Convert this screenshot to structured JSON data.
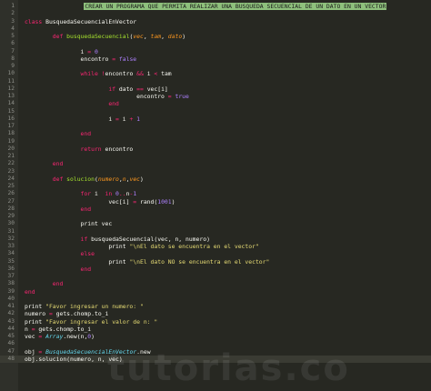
{
  "editor": {
    "lines": [
      {
        "n": "1",
        "segments": [
          {
            "t": "                 ",
            "c": "plain"
          },
          {
            "t": "CREAR UN PROGRAMA QUE PERMITA REALIZAR UNA BUSQUEDA SECUENCIAL DE UN DATO EN UN VECTOR",
            "c": "comment-hl"
          }
        ]
      },
      {
        "n": "2",
        "segments": [
          {
            "t": "",
            "c": "plain"
          }
        ]
      },
      {
        "n": "3",
        "segments": [
          {
            "t": "class ",
            "c": "kw"
          },
          {
            "t": "BusquedaSecuencialEnVector",
            "c": "plain"
          }
        ]
      },
      {
        "n": "4",
        "segments": [
          {
            "t": "",
            "c": "plain"
          }
        ]
      },
      {
        "n": "5",
        "segments": [
          {
            "t": "        def ",
            "c": "kw"
          },
          {
            "t": "busquedaSecuencial",
            "c": "fn"
          },
          {
            "t": "(",
            "c": "plain"
          },
          {
            "t": "vec",
            "c": "param"
          },
          {
            "t": ", ",
            "c": "plain"
          },
          {
            "t": "tam",
            "c": "param"
          },
          {
            "t": ", ",
            "c": "plain"
          },
          {
            "t": "dato",
            "c": "param"
          },
          {
            "t": ")",
            "c": "plain"
          }
        ]
      },
      {
        "n": "6",
        "segments": [
          {
            "t": "",
            "c": "plain"
          }
        ]
      },
      {
        "n": "7",
        "segments": [
          {
            "t": "                i ",
            "c": "plain"
          },
          {
            "t": "=",
            "c": "kw"
          },
          {
            "t": " ",
            "c": "plain"
          },
          {
            "t": "0",
            "c": "num"
          }
        ]
      },
      {
        "n": "8",
        "segments": [
          {
            "t": "                encontro ",
            "c": "plain"
          },
          {
            "t": "=",
            "c": "kw"
          },
          {
            "t": " ",
            "c": "plain"
          },
          {
            "t": "false",
            "c": "num"
          }
        ]
      },
      {
        "n": "9",
        "segments": [
          {
            "t": "",
            "c": "plain"
          }
        ]
      },
      {
        "n": "10",
        "segments": [
          {
            "t": "                while ",
            "c": "kw"
          },
          {
            "t": "!",
            "c": "kw"
          },
          {
            "t": "encontro ",
            "c": "plain"
          },
          {
            "t": "&&",
            "c": "kw"
          },
          {
            "t": " i ",
            "c": "plain"
          },
          {
            "t": "<",
            "c": "kw"
          },
          {
            "t": " tam",
            "c": "plain"
          }
        ]
      },
      {
        "n": "11",
        "segments": [
          {
            "t": "",
            "c": "plain"
          }
        ]
      },
      {
        "n": "12",
        "segments": [
          {
            "t": "                        if ",
            "c": "kw"
          },
          {
            "t": "dato ",
            "c": "plain"
          },
          {
            "t": "==",
            "c": "kw"
          },
          {
            "t": " vec[i]",
            "c": "plain"
          }
        ]
      },
      {
        "n": "13",
        "segments": [
          {
            "t": "                                encontro ",
            "c": "plain"
          },
          {
            "t": "=",
            "c": "kw"
          },
          {
            "t": " ",
            "c": "plain"
          },
          {
            "t": "true",
            "c": "num"
          }
        ]
      },
      {
        "n": "14",
        "segments": [
          {
            "t": "                        end",
            "c": "kw"
          }
        ]
      },
      {
        "n": "15",
        "segments": [
          {
            "t": "",
            "c": "plain"
          }
        ]
      },
      {
        "n": "16",
        "segments": [
          {
            "t": "                        i ",
            "c": "plain"
          },
          {
            "t": "=",
            "c": "kw"
          },
          {
            "t": " i ",
            "c": "plain"
          },
          {
            "t": "+",
            "c": "kw"
          },
          {
            "t": " ",
            "c": "plain"
          },
          {
            "t": "1",
            "c": "num"
          }
        ]
      },
      {
        "n": "17",
        "segments": [
          {
            "t": "",
            "c": "plain"
          }
        ]
      },
      {
        "n": "18",
        "segments": [
          {
            "t": "                end",
            "c": "kw"
          }
        ]
      },
      {
        "n": "19",
        "segments": [
          {
            "t": "",
            "c": "plain"
          }
        ]
      },
      {
        "n": "20",
        "segments": [
          {
            "t": "                return ",
            "c": "kw"
          },
          {
            "t": "encontro",
            "c": "plain"
          }
        ]
      },
      {
        "n": "21",
        "segments": [
          {
            "t": "",
            "c": "plain"
          }
        ]
      },
      {
        "n": "22",
        "segments": [
          {
            "t": "        end",
            "c": "kw"
          }
        ]
      },
      {
        "n": "23",
        "segments": [
          {
            "t": "",
            "c": "plain"
          }
        ]
      },
      {
        "n": "24",
        "segments": [
          {
            "t": "        def ",
            "c": "kw"
          },
          {
            "t": "solucion",
            "c": "fn"
          },
          {
            "t": "(",
            "c": "plain"
          },
          {
            "t": "numero",
            "c": "param"
          },
          {
            "t": ",",
            "c": "plain"
          },
          {
            "t": "n",
            "c": "param"
          },
          {
            "t": ",",
            "c": "plain"
          },
          {
            "t": "vec",
            "c": "param"
          },
          {
            "t": ")",
            "c": "plain"
          }
        ]
      },
      {
        "n": "25",
        "segments": [
          {
            "t": "",
            "c": "plain"
          }
        ]
      },
      {
        "n": "26",
        "segments": [
          {
            "t": "                for ",
            "c": "kw"
          },
          {
            "t": "i  ",
            "c": "plain"
          },
          {
            "t": "in ",
            "c": "kw"
          },
          {
            "t": "0",
            "c": "num"
          },
          {
            "t": "..",
            "c": "kw"
          },
          {
            "t": "n",
            "c": "plain"
          },
          {
            "t": "-",
            "c": "kw"
          },
          {
            "t": "1",
            "c": "num"
          }
        ]
      },
      {
        "n": "27",
        "segments": [
          {
            "t": "                        vec[i] ",
            "c": "plain"
          },
          {
            "t": "=",
            "c": "kw"
          },
          {
            "t": " rand(",
            "c": "plain"
          },
          {
            "t": "1001",
            "c": "num"
          },
          {
            "t": ")",
            "c": "plain"
          }
        ]
      },
      {
        "n": "28",
        "segments": [
          {
            "t": "                end",
            "c": "kw"
          }
        ]
      },
      {
        "n": "29",
        "segments": [
          {
            "t": "",
            "c": "plain"
          }
        ]
      },
      {
        "n": "30",
        "segments": [
          {
            "t": "                print ",
            "c": "plain"
          },
          {
            "t": "vec",
            "c": "plain"
          }
        ]
      },
      {
        "n": "31",
        "segments": [
          {
            "t": "",
            "c": "plain"
          }
        ]
      },
      {
        "n": "32",
        "segments": [
          {
            "t": "                if ",
            "c": "kw"
          },
          {
            "t": "busquedaSecuencial(vec, n, numero)",
            "c": "plain"
          }
        ]
      },
      {
        "n": "33",
        "segments": [
          {
            "t": "                        print ",
            "c": "plain"
          },
          {
            "t": "\"\\nEl dato se encuentra en el vector\"",
            "c": "str"
          }
        ]
      },
      {
        "n": "34",
        "segments": [
          {
            "t": "                else",
            "c": "kw"
          }
        ]
      },
      {
        "n": "35",
        "segments": [
          {
            "t": "                        print ",
            "c": "plain"
          },
          {
            "t": "\"\\nEl dato NO se encuentra en el vector\"",
            "c": "str"
          }
        ]
      },
      {
        "n": "36",
        "segments": [
          {
            "t": "                end",
            "c": "kw"
          }
        ]
      },
      {
        "n": "37",
        "segments": [
          {
            "t": "",
            "c": "plain"
          }
        ]
      },
      {
        "n": "38",
        "segments": [
          {
            "t": "        end",
            "c": "kw"
          }
        ]
      },
      {
        "n": "39",
        "segments": [
          {
            "t": "end",
            "c": "kw"
          }
        ]
      },
      {
        "n": "40",
        "segments": [
          {
            "t": "",
            "c": "plain"
          }
        ]
      },
      {
        "n": "41",
        "segments": [
          {
            "t": "print ",
            "c": "plain"
          },
          {
            "t": "\"Favor ingresar un numero: \"",
            "c": "str"
          }
        ]
      },
      {
        "n": "42",
        "segments": [
          {
            "t": "numero ",
            "c": "plain"
          },
          {
            "t": "=",
            "c": "kw"
          },
          {
            "t": " gets.chomp.to_i",
            "c": "plain"
          }
        ]
      },
      {
        "n": "43",
        "segments": [
          {
            "t": "print ",
            "c": "plain"
          },
          {
            "t": "\"Favor ingresar el valor de n: \"",
            "c": "str"
          }
        ]
      },
      {
        "n": "44",
        "segments": [
          {
            "t": "n ",
            "c": "plain"
          },
          {
            "t": "=",
            "c": "kw"
          },
          {
            "t": " gets.chomp.to_i",
            "c": "plain"
          }
        ]
      },
      {
        "n": "45",
        "segments": [
          {
            "t": "vec ",
            "c": "plain"
          },
          {
            "t": "=",
            "c": "kw"
          },
          {
            "t": " ",
            "c": "plain"
          },
          {
            "t": "Array",
            "c": "cls"
          },
          {
            "t": ".new(n,",
            "c": "plain"
          },
          {
            "t": "0",
            "c": "num"
          },
          {
            "t": ")",
            "c": "plain"
          }
        ]
      },
      {
        "n": "46",
        "segments": [
          {
            "t": "",
            "c": "plain"
          }
        ]
      },
      {
        "n": "47",
        "segments": [
          {
            "t": "obj ",
            "c": "plain"
          },
          {
            "t": "=",
            "c": "kw"
          },
          {
            "t": " ",
            "c": "plain"
          },
          {
            "t": "BusquedaSecuencialEnVector",
            "c": "cls"
          },
          {
            "t": ".new",
            "c": "plain"
          }
        ]
      },
      {
        "n": "48",
        "segments": [
          {
            "t": "obj.solucion(numero, n, vec)",
            "c": "plain"
          }
        ]
      }
    ],
    "active_line": "48"
  },
  "watermark": "tutorias.co",
  "colors": {
    "background": "#272822",
    "keyword": "#f92672",
    "function": "#a6e22e",
    "number": "#ae81ff",
    "string": "#e6db74",
    "comment_highlight": "#8ec07c"
  }
}
